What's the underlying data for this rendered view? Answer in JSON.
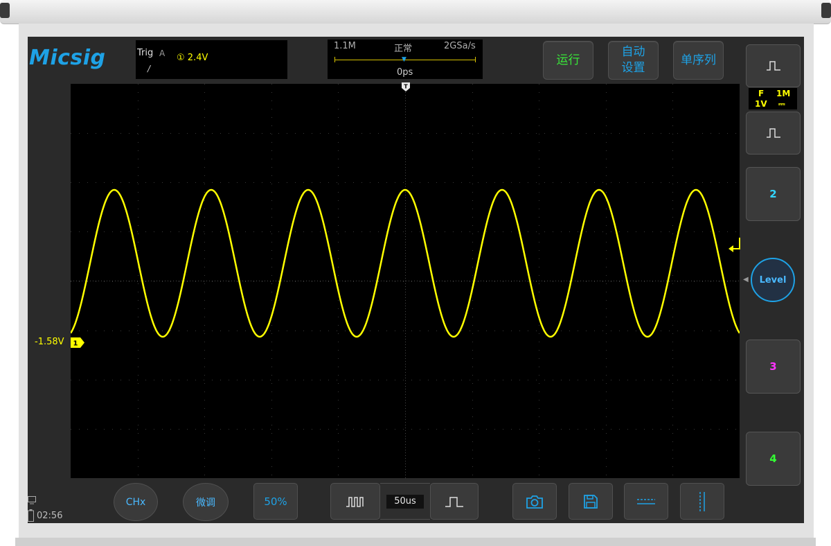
{
  "brand": "Micsig",
  "trigger": {
    "label": "Trig",
    "source": "A",
    "level": "① 2.4V",
    "edge": "/"
  },
  "timebase_info": {
    "memory_depth": "1.1M",
    "mode": "正常",
    "sample_rate": "2GSa/s",
    "position": "0ps",
    "marker": "T"
  },
  "top_buttons": {
    "run": "运行",
    "auto_setup_line1": "自动",
    "auto_setup_line2": "设置",
    "single": "单序列"
  },
  "channel1": {
    "marker": "1",
    "offset_label": "-1.58V",
    "trace_color": "#ffff00"
  },
  "side_panel": {
    "ch1_info": {
      "coupling": "F",
      "impedance": "1M",
      "scale": "1V",
      "dc": "⎓"
    },
    "ch2": "2",
    "level": "Level",
    "ch3": "3",
    "ch4": "4",
    "ch2_color": "#33d6ff",
    "ch3_color": "#ff33ff",
    "ch4_color": "#33ff33"
  },
  "bottom": {
    "chx": "CHx",
    "fine": "微调",
    "fifty": "50%",
    "timebase": "50us"
  },
  "status": {
    "time": "02:56"
  },
  "colors": {
    "accent": "#1ea2e6",
    "run_green": "#39e639",
    "background": "#2a2a2a",
    "screen": "#000000"
  }
}
